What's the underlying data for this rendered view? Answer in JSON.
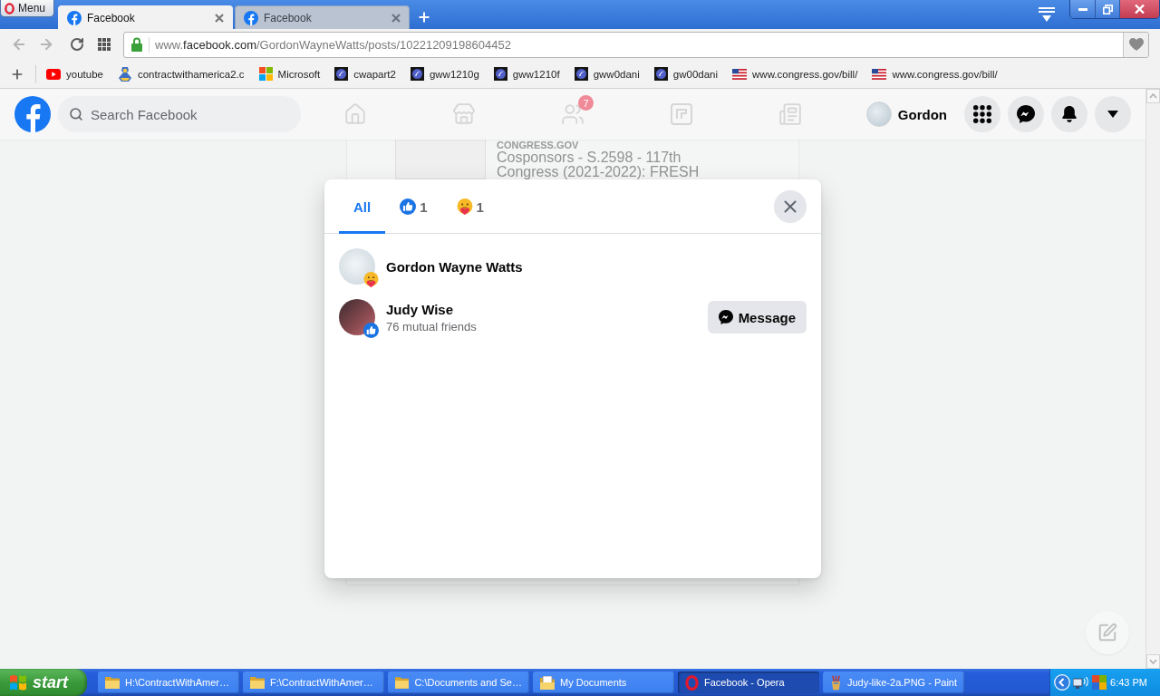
{
  "browser": {
    "menu_label": "Menu",
    "tabs": [
      {
        "title": "Facebook",
        "selected": true
      },
      {
        "title": "Facebook",
        "selected": false
      }
    ],
    "address": {
      "prefix": "www.",
      "domain": "facebook.com",
      "path": "/GordonWayneWatts/posts/10221209198604452"
    },
    "bookmarks": [
      {
        "label": "youtube",
        "kind": "youtube"
      },
      {
        "label": "contractwithamerica2.c",
        "kind": "mascot"
      },
      {
        "label": "Microsoft",
        "kind": "microsoft"
      },
      {
        "label": "cwapart2",
        "kind": "orb"
      },
      {
        "label": "gww1210g",
        "kind": "orb"
      },
      {
        "label": "gww1210f",
        "kind": "orb"
      },
      {
        "label": "gww0dani",
        "kind": "orb"
      },
      {
        "label": "gw00dani",
        "kind": "orb"
      },
      {
        "label": "www.congress.gov/bill/",
        "kind": "flag"
      },
      {
        "label": "www.congress.gov/bill/",
        "kind": "flag"
      }
    ]
  },
  "facebook_header": {
    "search": {
      "placeholder": "Search Facebook"
    },
    "nav": [
      {
        "kind": "home"
      },
      {
        "kind": "store"
      },
      {
        "kind": "groups",
        "badge": "7"
      },
      {
        "kind": "square"
      },
      {
        "kind": "news"
      }
    ],
    "profile_name": "Gordon",
    "actions": [
      {
        "kind": "grid"
      },
      {
        "kind": "chat"
      },
      {
        "kind": "bell"
      },
      {
        "kind": "caret"
      }
    ]
  },
  "post_preview": {
    "source": "CONGRESS.GOV",
    "title": "Cosponsors - S.2598 - 117th Congress (2021-2022): FRESH"
  },
  "reactions_dialog": {
    "tabs": [
      {
        "kind": "all",
        "label": "All",
        "selected": true
      },
      {
        "kind": "like",
        "count": "1",
        "selected": false
      },
      {
        "kind": "care",
        "count": "1",
        "selected": false
      }
    ],
    "people": [
      {
        "name": "Gordon Wayne Watts",
        "reaction": {
          "kind": "care"
        }
      },
      {
        "name": "Judy Wise",
        "subtitle": "76 mutual friends",
        "reaction": {
          "kind": "like"
        },
        "action": "Message"
      }
    ]
  },
  "taskbar": {
    "start_label": "start",
    "tasks": [
      {
        "label": "H:\\ContractWithAmer…",
        "kind": "folder",
        "selected": false
      },
      {
        "label": "F:\\ContractWithAmer…",
        "kind": "folder",
        "selected": false
      },
      {
        "label": "C:\\Documents and Se…",
        "kind": "folder",
        "selected": false
      },
      {
        "label": "My Documents",
        "kind": "documents",
        "selected": false
      },
      {
        "label": "Facebook - Opera",
        "kind": "opera",
        "selected": true
      },
      {
        "label": "Judy-like-2a.PNG - Paint",
        "kind": "paint",
        "selected": false
      }
    ],
    "clock": "6:43 PM"
  }
}
